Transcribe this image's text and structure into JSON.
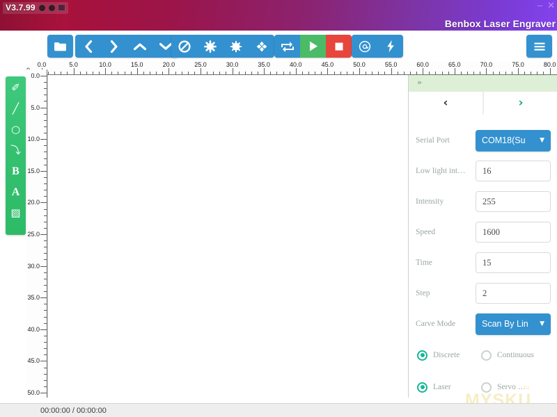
{
  "titlebar": {
    "version": "V3.7.99",
    "app_title": "Benbox Laser Engraver",
    "icons": [
      "settings-circle-icon",
      "help-circle-icon",
      "flag-icon"
    ],
    "window_controls": {
      "minimize": "–",
      "close": "✕"
    },
    "gradient_from": "#8d1033",
    "gradient_to": "#8243ef"
  },
  "toolbar": {
    "groups": [
      {
        "name": "file",
        "buttons": [
          {
            "name": "open-file-button",
            "icon": "folder-icon"
          }
        ]
      },
      {
        "name": "navigation",
        "buttons": [
          {
            "name": "move-left-button",
            "icon": "chevron-left-icon"
          },
          {
            "name": "move-right-button",
            "icon": "chevron-right-icon"
          },
          {
            "name": "move-up-button",
            "icon": "chevron-up-icon"
          },
          {
            "name": "move-down-button",
            "icon": "chevron-down-icon"
          }
        ]
      },
      {
        "name": "shapes",
        "buttons": [
          {
            "name": "no-entry-button",
            "icon": "ban-icon"
          },
          {
            "name": "burst-button",
            "icon": "asterisk-burst-icon"
          },
          {
            "name": "sun-button",
            "icon": "sun-icon"
          },
          {
            "name": "crosshair-button",
            "icon": "diamond-crosshair-icon"
          }
        ]
      },
      {
        "name": "run",
        "buttons": [
          {
            "name": "reset-button",
            "icon": "refresh-icon",
            "color": "#3391cf"
          },
          {
            "name": "start-button",
            "icon": "play-icon",
            "color": "#4cbb67"
          },
          {
            "name": "stop-button",
            "icon": "stop-icon",
            "color": "#e8453c"
          }
        ]
      },
      {
        "name": "laser",
        "buttons": [
          {
            "name": "center-target-button",
            "icon": "target-at-icon"
          },
          {
            "name": "laser-power-button",
            "icon": "lightning-bolt-icon"
          }
        ]
      },
      {
        "name": "menu",
        "buttons": [
          {
            "name": "hamburger-menu-button",
            "icon": "hamburger-icon"
          }
        ]
      }
    ],
    "annotation": {
      "name": "red-arrow-annotation",
      "points_to": "laser-power-button",
      "color": "#cc1111"
    }
  },
  "left_tools": {
    "items": [
      {
        "name": "tool-select-tag",
        "icon": "tag-icon",
        "glyph": "✐"
      },
      {
        "name": "tool-line",
        "icon": "line-icon",
        "glyph": "╱"
      },
      {
        "name": "tool-circle",
        "icon": "circle-icon",
        "glyph": "○"
      },
      {
        "name": "tool-curve",
        "icon": "curve-icon",
        "glyph": "⤵"
      },
      {
        "name": "tool-bold-bezier",
        "icon": "letter-b-icon",
        "glyph": "B"
      },
      {
        "name": "tool-text",
        "icon": "letter-a-icon",
        "glyph": "A"
      },
      {
        "name": "tool-image",
        "icon": "image-icon",
        "glyph": "▨"
      }
    ],
    "color": "#34c06f"
  },
  "rulers": {
    "horizontal": {
      "unit_step": 5.0,
      "labels": [
        "0.0",
        "5.0",
        "10.0",
        "15.0",
        "20.0",
        "25.0",
        "30.0",
        "35.0",
        "40.0",
        "45.0",
        "50.0",
        "55.0",
        "60.0",
        "65.0",
        "70.0",
        "75.0",
        "80.0"
      ],
      "range": [
        0.0,
        80.0
      ]
    },
    "vertical": {
      "unit_step": 5.0,
      "labels": [
        "0.0",
        "5.0",
        "10.0",
        "15.0",
        "20.0",
        "25.0",
        "30.0",
        "35.0",
        "40.0",
        "45.0",
        "50.0"
      ],
      "range": [
        0.0,
        50.0
      ]
    },
    "origin_label": "0.0"
  },
  "settings_panel": {
    "collapse_chevron": "»",
    "tabs": [
      {
        "name": "tab-previous",
        "icon": "chevron-left-icon",
        "glyph": "‹",
        "active": true
      },
      {
        "name": "tab-next",
        "icon": "chevron-right-icon",
        "glyph": "›",
        "active": false
      }
    ],
    "fields": [
      {
        "name": "serial-port",
        "label": "Serial Port",
        "type": "select",
        "value": "COM18(Su"
      },
      {
        "name": "low-light-int",
        "label": "Low light int…",
        "type": "input",
        "value": "16"
      },
      {
        "name": "intensity",
        "label": "Intensity",
        "type": "input",
        "value": "255"
      },
      {
        "name": "speed",
        "label": "Speed",
        "type": "input",
        "value": "1600"
      },
      {
        "name": "time",
        "label": "Time",
        "type": "input",
        "value": "15"
      },
      {
        "name": "step",
        "label": "Step",
        "type": "input",
        "value": "2"
      },
      {
        "name": "carve-mode",
        "label": "Carve Mode",
        "type": "select",
        "value": "Scan By Lin"
      }
    ],
    "radio_groups": [
      {
        "name": "mode-group",
        "options": [
          {
            "name": "radio-discrete",
            "label": "Discrete",
            "selected": true
          },
          {
            "name": "radio-continuous",
            "label": "Continuous",
            "selected": false
          }
        ]
      },
      {
        "name": "device-group",
        "options": [
          {
            "name": "radio-laser",
            "label": "Laser",
            "selected": true
          },
          {
            "name": "radio-servo",
            "label": "Servo …",
            "selected": false
          }
        ]
      }
    ],
    "accent_color": "#3391cf",
    "radio_on_color": "#16b596"
  },
  "statusbar": {
    "time": "00:00:00 / 00:00:00"
  },
  "watermark": {
    "text": "MYSKU",
    "suffix": "ru"
  }
}
